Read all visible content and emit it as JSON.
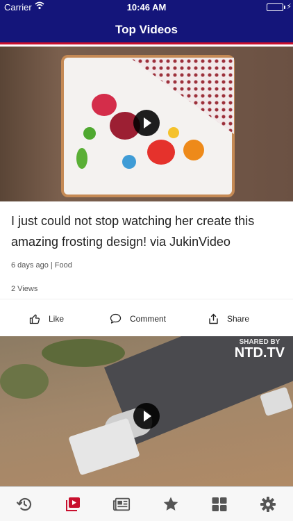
{
  "status_bar": {
    "carrier": "Carrier",
    "time": "10:46 AM"
  },
  "nav": {
    "title": "Top Videos"
  },
  "feed": [
    {
      "headline": "I just could not stop watching her create this amazing frosting design! via JukinVideo",
      "meta": "6 days ago | Food",
      "views": "2 Views"
    },
    {
      "watermark_top": "SHARED BY",
      "watermark_main": "NTD.TV"
    }
  ],
  "actions": {
    "like": "Like",
    "comment": "Comment",
    "share": "Share"
  },
  "tabbar": {
    "items": [
      {
        "icon": "history-icon",
        "active": false
      },
      {
        "icon": "video-icon",
        "active": true
      },
      {
        "icon": "newspaper-icon",
        "active": false
      },
      {
        "icon": "star-icon",
        "active": false
      },
      {
        "icon": "grid-icon",
        "active": false
      },
      {
        "icon": "gear-icon",
        "active": false
      }
    ],
    "active_color": "#c8102e",
    "inactive_color": "#555555"
  },
  "colors": {
    "header_bg": "#14157a",
    "header_accent": "#c8102e"
  }
}
